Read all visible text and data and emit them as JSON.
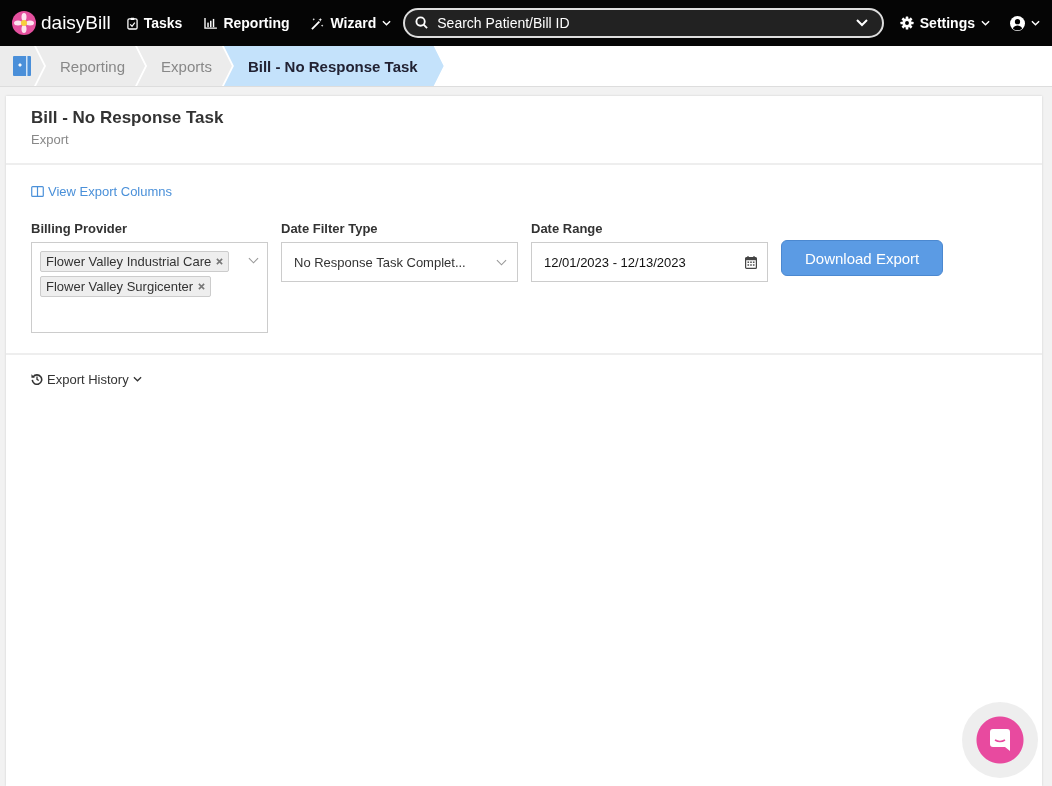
{
  "topbar": {
    "logo": "daisy**Bill**",
    "nav": [
      {
        "kind": "tasks",
        "label": "Tasks",
        "caret": false
      },
      {
        "kind": "reporting",
        "label": "Reporting",
        "caret": false
      },
      {
        "kind": "wizard",
        "label": "Wizard",
        "caret": true
      }
    ],
    "search": {
      "placeholder": "Search Patient/Bill ID"
    },
    "settings": {
      "label": "Settings"
    }
  },
  "breadcrumbs": [
    {
      "label": "Reporting",
      "selected": false
    },
    {
      "label": "Exports",
      "selected": false
    },
    {
      "label": "Bill - No Response Task",
      "selected": true
    }
  ],
  "header": {
    "title": "Bill - No Response Task",
    "subtitle": "Export"
  },
  "view_columns_link": "View Export Columns",
  "filters": {
    "billing_provider": {
      "label": "Billing Provider",
      "tags": [
        "Flower Valley Industrial Care",
        "Flower Valley Surgicenter"
      ]
    },
    "date_filter_type": {
      "label": "Date Filter Type",
      "value": "No Response Task Complet..."
    },
    "date_range": {
      "label": "Date Range",
      "value": "12/01/2023 - 12/13/2023"
    },
    "download_button": "Download Export"
  },
  "export_history": "Export History"
}
